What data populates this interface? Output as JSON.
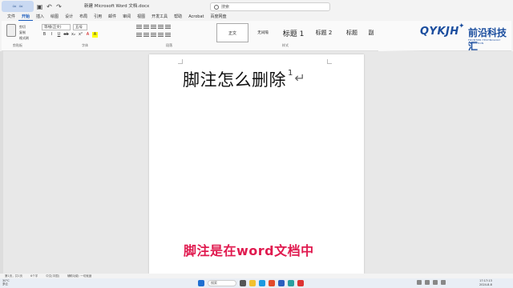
{
  "titlebar": {
    "doc_title": "新建 Microsoft Word 文档.docx",
    "search_placeholder": "搜索"
  },
  "tabs": [
    "文件",
    "开始",
    "插入",
    "绘图",
    "设计",
    "布局",
    "引用",
    "邮件",
    "审阅",
    "视图",
    "开发工具",
    "帮助",
    "Acrobat",
    "百度网盘"
  ],
  "ribbon": {
    "clipboard_label": "剪贴板",
    "cut": "剪切",
    "copy": "复制",
    "format_painter": "格式刷",
    "font_name": "等线(正文)",
    "font_size": "五号",
    "font_label": "字体",
    "paragraph_label": "段落",
    "styles_label": "样式",
    "styles": [
      "正文",
      "无间隔",
      "标题 1",
      "标题 2",
      "标题",
      "副"
    ]
  },
  "brand": {
    "logo_text": "QYKJH",
    "name": "前沿科技汇",
    "subtitle": "FRONTIER TECHNOLOGY EDUCATION"
  },
  "document": {
    "heading": "脚注怎么删除",
    "footnote_mark": "1",
    "caption": "脚注是在word文档中"
  },
  "statusbar": {
    "page": "第1页，共1页",
    "words": "6个字",
    "lang": "中文(中国)",
    "accessibility": "辅助功能: 一切就绪"
  },
  "taskbar": {
    "weather_temp": "30°C",
    "weather_desc": "多云",
    "search": "搜索",
    "time": "17:17:13",
    "date": "2024-8-8"
  }
}
